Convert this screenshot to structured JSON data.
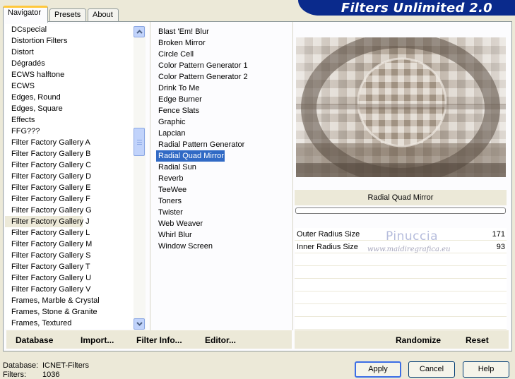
{
  "tabs": [
    {
      "label": "Navigator",
      "active": true
    },
    {
      "label": "Presets",
      "active": false
    },
    {
      "label": "About",
      "active": false
    }
  ],
  "banner": {
    "title": "Filters Unlimited 2.0"
  },
  "categories": [
    "DCspecial",
    "Distortion Filters",
    "Distort",
    "Dégradés",
    "ECWS halftone",
    "ECWS",
    "Edges, Round",
    "Edges, Square",
    "Effects",
    "FFG???",
    "Filter Factory Gallery A",
    "Filter Factory Gallery B",
    "Filter Factory Gallery C",
    "Filter Factory Gallery D",
    "Filter Factory Gallery E",
    "Filter Factory Gallery F",
    "Filter Factory Gallery G",
    "Filter Factory Gallery J",
    "Filter Factory Gallery L",
    "Filter Factory Gallery M",
    "Filter Factory Gallery S",
    "Filter Factory Gallery T",
    "Filter Factory Gallery U",
    "Filter Factory Gallery V",
    "Frames, Marble & Crystal",
    "Frames, Stone & Granite",
    "Frames, Textured"
  ],
  "selected_category_index": 17,
  "filters": [
    "Blast 'Em! Blur",
    "Broken Mirror",
    "Circle Cell",
    "Color Pattern Generator 1",
    "Color Pattern Generator 2",
    "Drink To Me",
    "Edge Burner",
    "Fence Slats",
    "Graphic",
    "Lapcian",
    "Radial Pattern Generator",
    "Radial Quad Mirror",
    "Radial Sun",
    "Reverb",
    "TeeWee",
    "Toners",
    "Twister",
    "Web Weaver",
    "Whirl Blur",
    "Window Screen"
  ],
  "selected_filter_index": 11,
  "preview": {
    "filter_name": "Radial Quad Mirror",
    "progress": 0
  },
  "params": [
    {
      "label": "Outer Radius Size",
      "value": "171"
    },
    {
      "label": "Inner Radius Size",
      "value": "93"
    }
  ],
  "watermark": {
    "name": "Pinuccia",
    "url": "www.maidiregrafica.eu"
  },
  "left_buttons": {
    "database": "Database",
    "import": "Import...",
    "filter_info": "Filter Info...",
    "editor": "Editor..."
  },
  "right_buttons": {
    "randomize": "Randomize",
    "reset": "Reset"
  },
  "status": {
    "database_label": "Database:",
    "database_value": "ICNET-Filters",
    "filters_label": "Filters:",
    "filters_value": "1036"
  },
  "dialog_buttons": {
    "apply": "Apply",
    "cancel": "Cancel",
    "help": "Help"
  },
  "colors": {
    "selection": "#316ac5",
    "banner": "#0a2a8c",
    "tab_highlight": "#ffc83c"
  }
}
